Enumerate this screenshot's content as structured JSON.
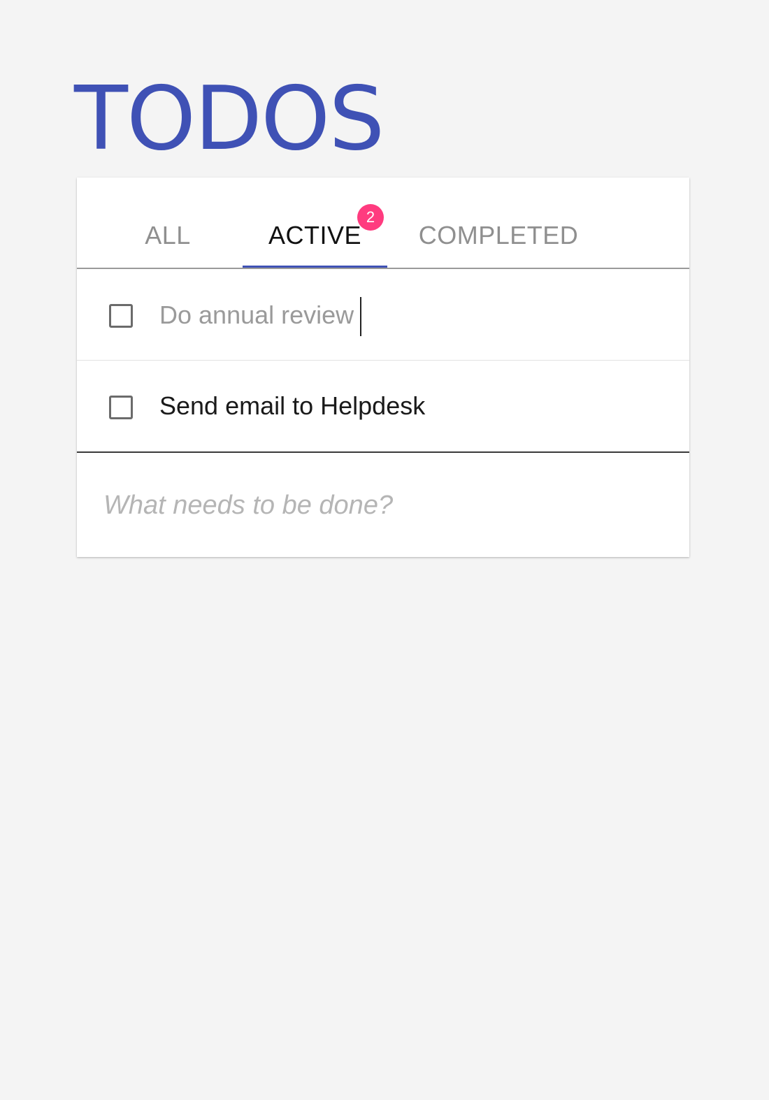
{
  "app": {
    "title": "TODOS",
    "accent_color": "#3f51b5",
    "badge_color": "#ff3b7f"
  },
  "tabs": [
    {
      "label": "ALL",
      "selected": false
    },
    {
      "label": "ACTIVE",
      "selected": true,
      "badge": "2"
    },
    {
      "label": "COMPLETED",
      "selected": false
    }
  ],
  "todos": [
    {
      "text": "Do annual review",
      "checked": false,
      "editing": true
    },
    {
      "text": "Send email to Helpdesk",
      "checked": false,
      "editing": false
    }
  ],
  "new_todo": {
    "placeholder": "What needs to be done?",
    "value": ""
  }
}
